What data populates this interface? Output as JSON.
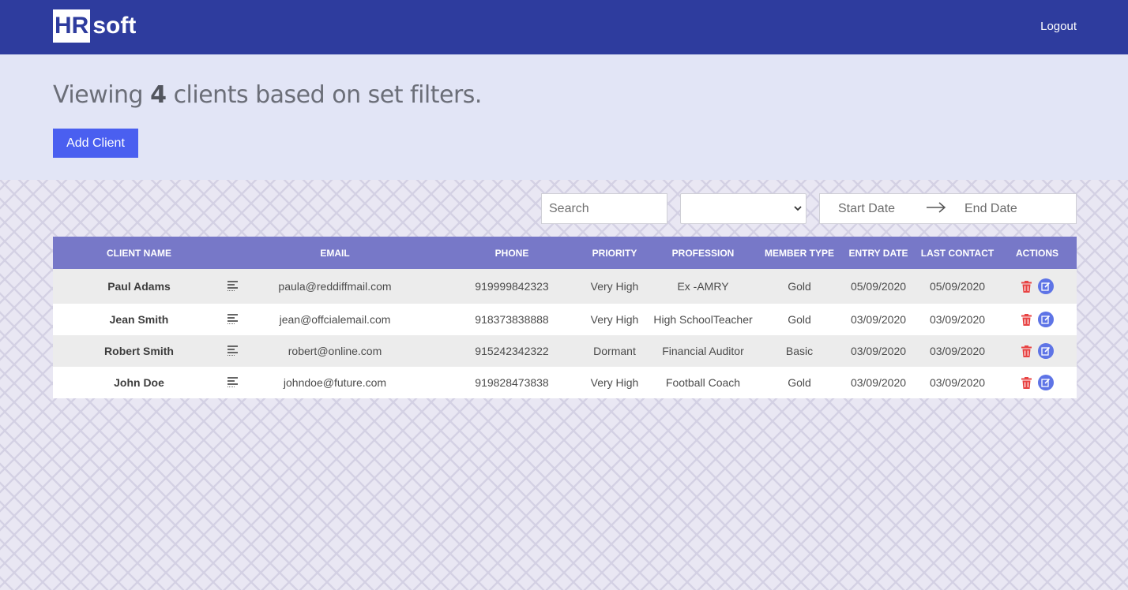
{
  "navbar": {
    "logo_box": "HR",
    "logo_rest": "soft",
    "logout_label": "Logout"
  },
  "header": {
    "title_prefix": "Viewing",
    "title_count": "4",
    "title_suffix": "clients based on set filters.",
    "add_button_label": "Add Client"
  },
  "filters": {
    "search_placeholder": "Search",
    "select_value": "",
    "start_date_placeholder": "Start Date",
    "end_date_placeholder": "End Date"
  },
  "table": {
    "headers": [
      "CLIENT NAME",
      "EMAIL",
      "PHONE",
      "PRIORITY",
      "PROFESSION",
      "MEMBER TYPE",
      "ENTRY DATE",
      "LAST CONTACT",
      "ACTIONS"
    ],
    "rows": [
      {
        "name": "Paul Adams",
        "email": "paula@reddiffmail.com",
        "phone": "919999842323",
        "priority": "Very High",
        "profession": "Ex -AMRY",
        "member": "Gold",
        "entry": "05/09/2020",
        "last": "05/09/2020"
      },
      {
        "name": "Jean Smith",
        "email": "jean@offcialemail.com",
        "phone": "918373838888",
        "priority": "Very High",
        "profession": "High SchoolTeacher",
        "member": "Gold",
        "entry": "03/09/2020",
        "last": "03/09/2020"
      },
      {
        "name": "Robert Smith",
        "email": "robert@online.com",
        "phone": "915242342322",
        "priority": "Dormant",
        "profession": "Financial Auditor",
        "member": "Basic",
        "entry": "03/09/2020",
        "last": "03/09/2020"
      },
      {
        "name": "John Doe",
        "email": "johndoe@future.com",
        "phone": "919828473838",
        "priority": "Very High",
        "profession": "Football Coach",
        "member": "Gold",
        "entry": "03/09/2020",
        "last": "03/09/2020"
      }
    ]
  },
  "colors": {
    "navbar": "#2e3c9e",
    "header_band": "#e2e5f6",
    "button": "#4a5ff0",
    "table_header": "#7778c8",
    "delete": "#e84343",
    "edit": "#5e74e6"
  }
}
